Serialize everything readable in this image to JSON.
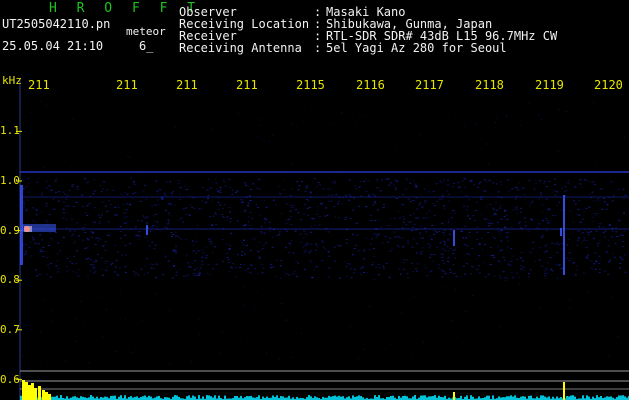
{
  "header": {
    "app_name": "H R O F F T",
    "file_name": "UT2505042110.pn",
    "tag": "meteor",
    "datetime": "25.05.04 21:10",
    "count": "6_",
    "info": [
      {
        "label": "Observer",
        "sep": ":",
        "value": "Masaki Kano"
      },
      {
        "label": "Receiving Location",
        "sep": ":",
        "value": "Shibukawa, Gunma, Japan"
      },
      {
        "label": "Receiver",
        "sep": ":",
        "value": "RTL-SDR SDR# 43dB L15 96.7MHz CW"
      },
      {
        "label": "Receiving Antenna",
        "sep": ":",
        "value": "5el Yagi Az 280 for Seoul"
      }
    ]
  },
  "axis": {
    "y_unit": "kHz",
    "x_ticks": [
      "211",
      "211",
      "211",
      "211",
      "2115",
      "2116",
      "2117",
      "2118",
      "2119",
      "2120"
    ],
    "y_ticks": [
      "1.1",
      "1.0",
      "0.9",
      "0.8",
      "0.7",
      "0.6"
    ],
    "y_values": [
      1.1,
      1.0,
      0.9,
      0.8,
      0.7,
      0.6
    ]
  },
  "colors": {
    "background": "#000000",
    "axis_text": "#e6e600",
    "title_green": "#1fc41f",
    "header_text": "#f2f2f2",
    "signal_blue": "#1a2acc",
    "spectrum_cyan": "#00e5ff",
    "spectrum_yellow": "#ffff00"
  }
}
